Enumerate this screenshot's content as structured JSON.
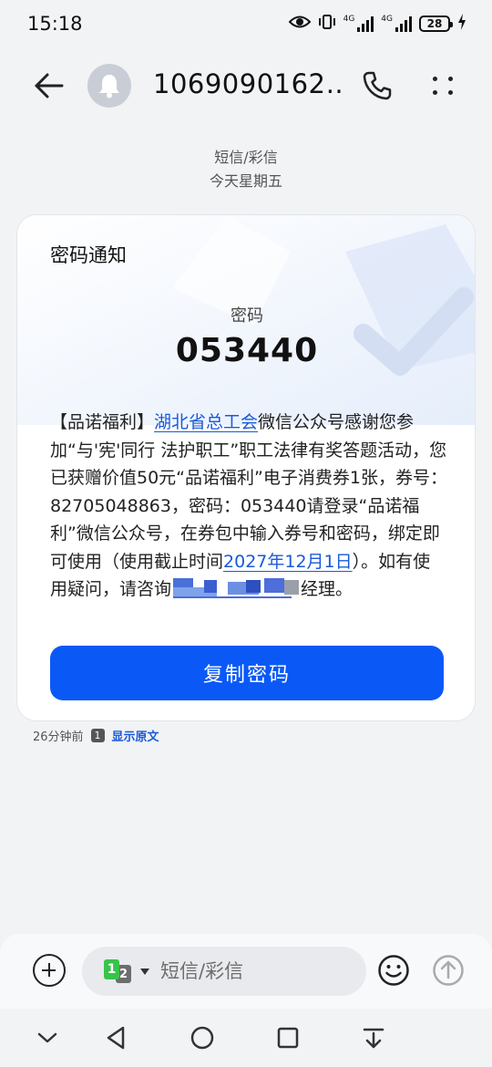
{
  "status_bar": {
    "time": "15:18",
    "network_1": "4G",
    "network_2": "4G",
    "battery": "28"
  },
  "header": {
    "contact_name": "1069090162…"
  },
  "thread_meta": {
    "channel": "短信/彩信",
    "date": "今天星期五"
  },
  "message_card": {
    "title": "密码通知",
    "code_label": "密码",
    "code_value": "053440",
    "body_part1": "【品诺福利】",
    "body_link1": "湖北省总工会",
    "body_part2": "微信公众号感谢您参加“与'宪'同行 法护职工”职工法律有奖答题活动，您已获赠价值50元“品诺福利”电子消费券1张，券号：82705048863，密码：053440请登录“品诺福利”微信公众号，在券包中输入券号和密码，绑定即可使用（使用截止时间",
    "body_link2": "2027年12月1日",
    "body_part3": "）。如有使用疑问，请咨询",
    "body_part4": "经理。",
    "copy_button": "复制密码"
  },
  "message_footer": {
    "time_ago": "26分钟前",
    "sim_number": "1",
    "show_original": "显示原文"
  },
  "composer": {
    "sim_primary": "1",
    "sim_secondary": "2",
    "placeholder": "短信/彩信"
  },
  "colors": {
    "accent": "#0a59f7",
    "link": "#1a5ad8",
    "background": "#f1f3f5"
  }
}
